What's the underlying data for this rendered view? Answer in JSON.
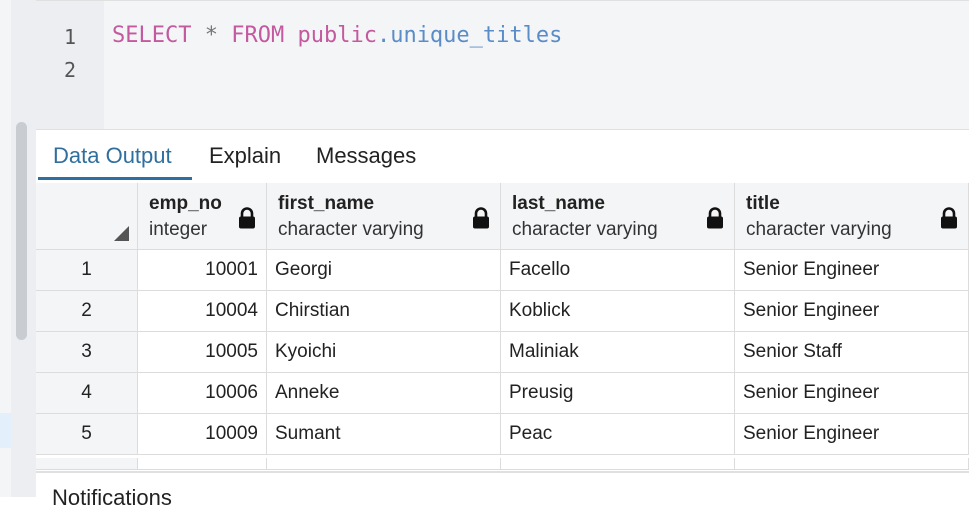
{
  "editor": {
    "line_numbers": [
      "1",
      "2"
    ],
    "code": {
      "kw1": "SELECT",
      "star": "*",
      "kw2": "FROM",
      "schema": "public",
      "dot_table": ".unique_titles"
    }
  },
  "tabs": [
    {
      "label": "Data Output",
      "active": true
    },
    {
      "label": "Explain",
      "active": false
    },
    {
      "label": "Messages",
      "active": false
    }
  ],
  "grid": {
    "columns": [
      {
        "name": "emp_no",
        "type": "integer"
      },
      {
        "name": "first_name",
        "type": "character varying"
      },
      {
        "name": "last_name",
        "type": "character varying"
      },
      {
        "name": "title",
        "type": "character varying"
      }
    ],
    "rows": [
      {
        "idx": "1",
        "emp_no": "10001",
        "first_name": "Georgi",
        "last_name": "Facello",
        "title": "Senior Engineer"
      },
      {
        "idx": "2",
        "emp_no": "10004",
        "first_name": "Chirstian",
        "last_name": "Koblick",
        "title": "Senior Engineer"
      },
      {
        "idx": "3",
        "emp_no": "10005",
        "first_name": "Kyoichi",
        "last_name": "Maliniak",
        "title": "Senior Staff"
      },
      {
        "idx": "4",
        "emp_no": "10006",
        "first_name": "Anneke",
        "last_name": "Preusig",
        "title": "Senior Engineer"
      },
      {
        "idx": "5",
        "emp_no": "10009",
        "first_name": "Sumant",
        "last_name": "Peac",
        "title": "Senior Engineer"
      }
    ]
  },
  "notifications": {
    "label": "Notifications"
  },
  "icons": {
    "lock": "lock-icon",
    "sort_corner": "corner-triangle-icon"
  },
  "colors": {
    "accent": "#2f6f9f",
    "keyword": "#c4599f",
    "identifier": "#5a8cc7"
  }
}
